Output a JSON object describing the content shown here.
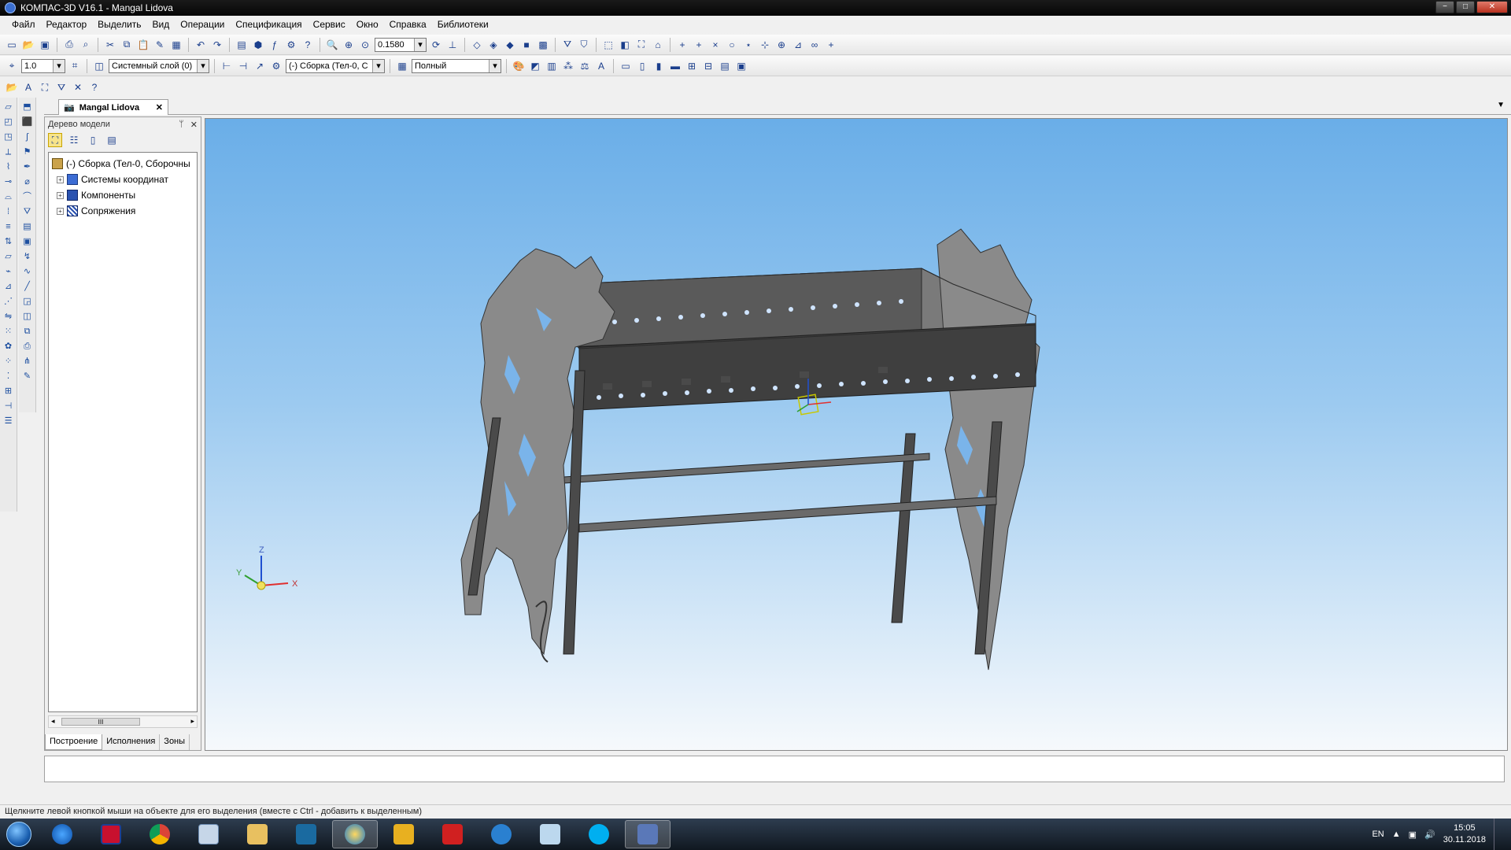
{
  "window": {
    "title": "КОМПАС-3D V16.1 - Mangal Lidova",
    "controls": {
      "minimize": "−",
      "maximize": "□",
      "close": "✕"
    }
  },
  "menu": [
    "Файл",
    "Редактор",
    "Выделить",
    "Вид",
    "Операции",
    "Спецификация",
    "Сервис",
    "Окно",
    "Справка",
    "Библиотеки"
  ],
  "toolbar1": {
    "zoom_value": "0.1580"
  },
  "toolbar2": {
    "step_value": "1.0",
    "layer": "Системный слой (0)",
    "assembly_select": "(-) Сборка (Тел-0, С",
    "display_mode": "Полный"
  },
  "document_tab": {
    "label": "Mangal Lidova",
    "close": "✕"
  },
  "tree_panel": {
    "title": "Дерево модели",
    "pin": "📌",
    "close": "✕",
    "root": "(-) Сборка (Тел-0, Сборочны",
    "items": [
      "Системы координат",
      "Компоненты",
      "Сопряжения"
    ],
    "scroll_grip": "III",
    "tabs": [
      "Построение",
      "Исполнения",
      "Зоны"
    ]
  },
  "axes": {
    "x": "X",
    "y": "Y",
    "z": "Z"
  },
  "colors": {
    "viewport_top": "#6aaee8",
    "viewport_bottom": "#f6f9fc",
    "model_gray": "#6e6e6e",
    "axis_x": "#e03030",
    "axis_y": "#2fa02f",
    "axis_z": "#2050d0"
  },
  "status_text": "Щелкните левой кнопкой мыши на объекте для его выделения (вместе с Ctrl - добавить к выделенным)",
  "tray": {
    "lang": "EN",
    "time": "15:05",
    "date": "30.11.2018"
  },
  "taskbar_apps": [
    "ie-icon",
    "kompas-icon",
    "chrome-icon",
    "calculator-icon",
    "explorer-icon",
    "nc-icon",
    "globe-icon",
    "tasks-icon",
    "mail-icon",
    "skype-chat-icon",
    "notes-icon",
    "skype-icon",
    "network-icon"
  ]
}
